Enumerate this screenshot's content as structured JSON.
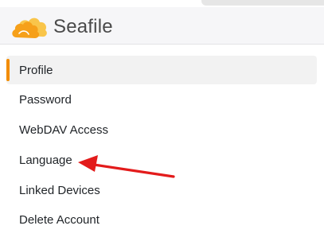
{
  "brand": {
    "name": "Seafile",
    "logo_icon": "seafile-cloud-logo",
    "logo_color_primary": "#f6a01a",
    "logo_color_secondary": "#f9c54a"
  },
  "menu": {
    "active_color": "#f28c00",
    "items": [
      {
        "label": "Profile",
        "active": true
      },
      {
        "label": "Password",
        "active": false
      },
      {
        "label": "WebDAV Access",
        "active": false
      },
      {
        "label": "Language",
        "active": false
      },
      {
        "label": "Linked Devices",
        "active": false
      },
      {
        "label": "Delete Account",
        "active": false
      }
    ]
  },
  "annotation": {
    "icon": "red-arrow-icon",
    "color": "#e31b1b",
    "target": "Language"
  }
}
